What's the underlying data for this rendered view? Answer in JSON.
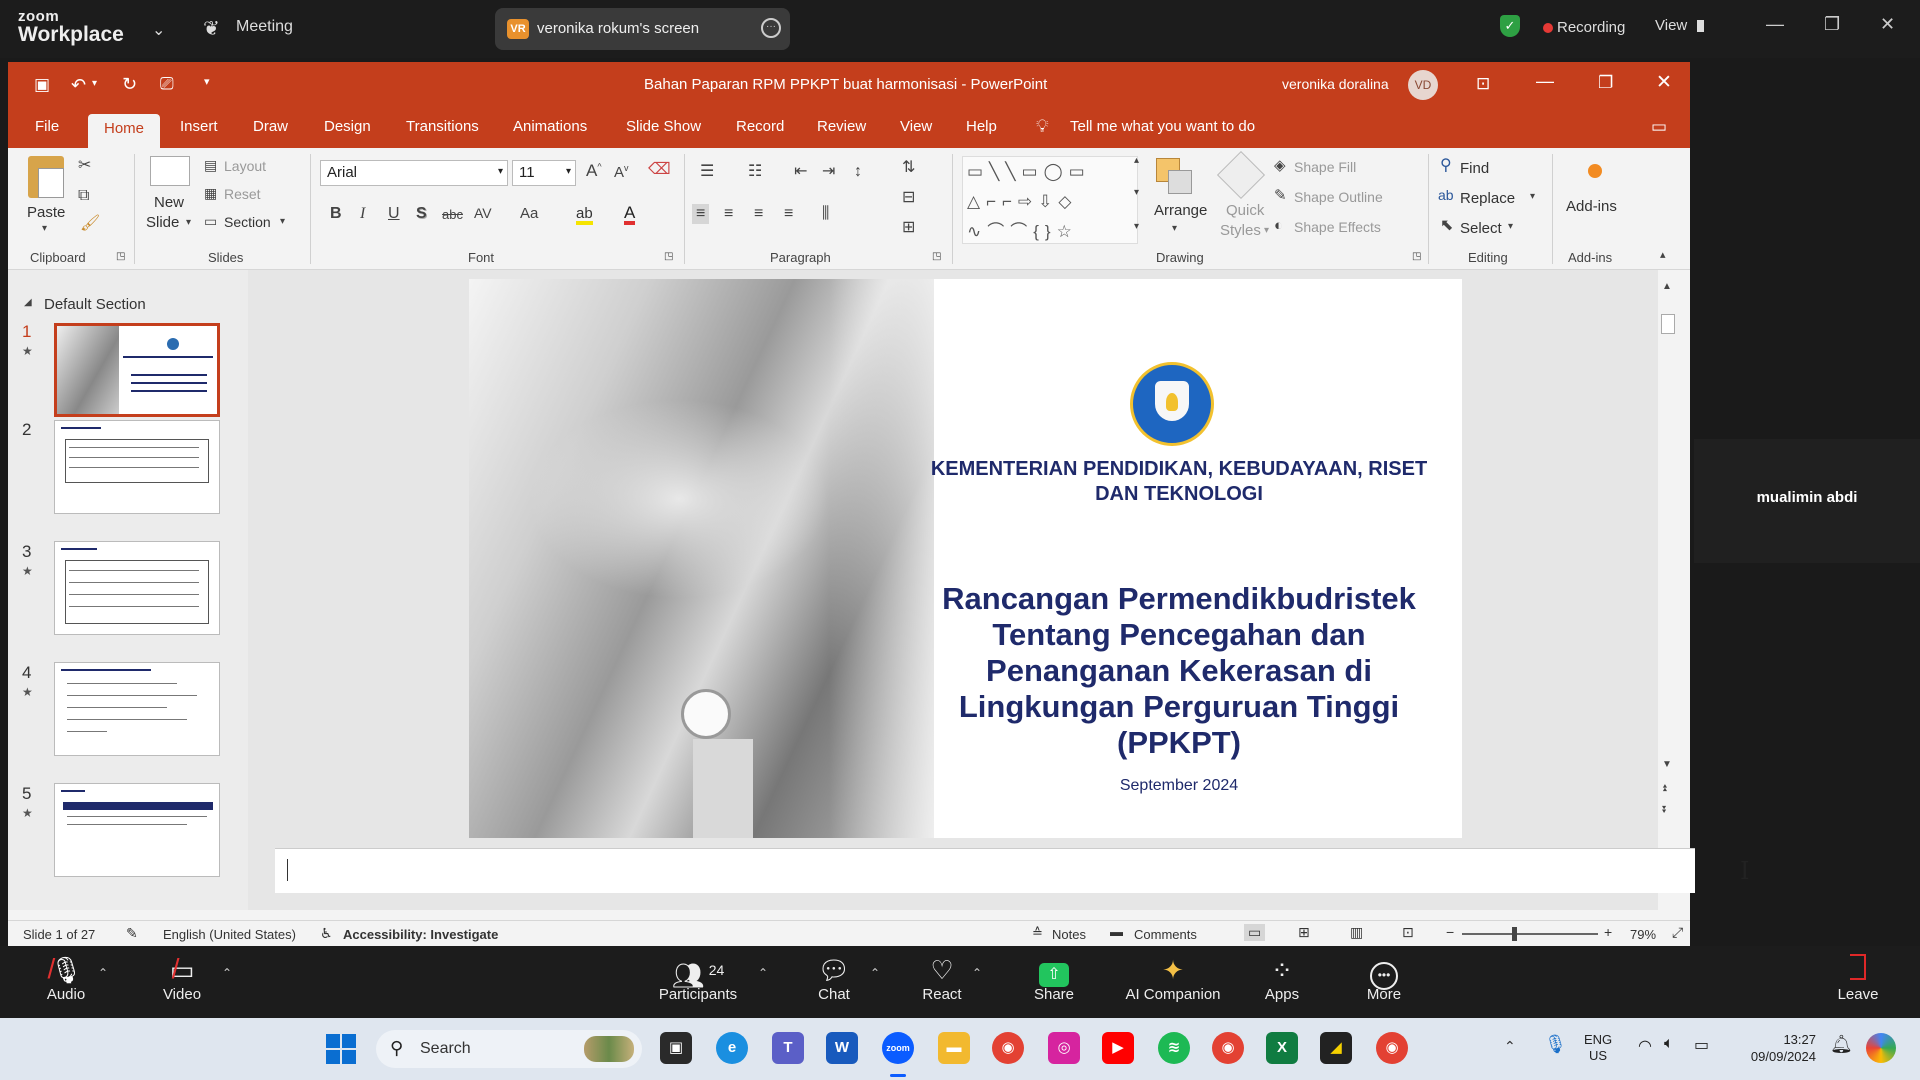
{
  "zoom": {
    "brand_top": "zoom",
    "brand_bottom": "Workplace",
    "meeting_label": "Meeting",
    "share_initials": "VR",
    "share_label": "veronika rokum's screen",
    "recording_label": "Recording",
    "view_label": "View",
    "participant_name": "mualimin abdi",
    "participants_count": "24",
    "toolbar": {
      "audio": "Audio",
      "video": "Video",
      "participants": "Participants",
      "chat": "Chat",
      "react": "React",
      "share": "Share",
      "ai": "AI Companion",
      "apps": "Apps",
      "more": "More",
      "leave": "Leave"
    },
    "colors": {
      "recording_dot": "#e53935",
      "share_green": "#22c55e",
      "leave_red": "#e02828"
    }
  },
  "ppt": {
    "title": "Bahan Paparan RPM PPKPT buat harmonisasi  -  PowerPoint",
    "user_name": "veronika doralina",
    "user_initials": "VD",
    "accent": "#c43e1c",
    "tabs": [
      "File",
      "Home",
      "Insert",
      "Draw",
      "Design",
      "Transitions",
      "Animations",
      "Slide Show",
      "Record",
      "Review",
      "View",
      "Help"
    ],
    "tell_me": "Tell me what you want to do",
    "ribbon": {
      "paste": "Paste",
      "new_slide_1": "New",
      "new_slide_2": "Slide",
      "layout": "Layout",
      "reset": "Reset",
      "section": "Section",
      "font_name": "Arial",
      "font_size": "11",
      "arrange": "Arrange",
      "quick_styles_1": "Quick",
      "quick_styles_2": "Styles",
      "shape_fill": "Shape Fill",
      "shape_outline": "Shape Outline",
      "shape_effects": "Shape Effects",
      "find": "Find",
      "replace": "Replace",
      "select": "Select",
      "addins": "Add-ins",
      "groups": {
        "clipboard": "Clipboard",
        "slides": "Slides",
        "font": "Font",
        "paragraph": "Paragraph",
        "drawing": "Drawing",
        "editing": "Editing",
        "addins": "Add-ins"
      }
    },
    "section_name": "Default Section",
    "thumbs": [
      {
        "num": "1"
      },
      {
        "num": "2"
      },
      {
        "num": "3"
      },
      {
        "num": "4"
      },
      {
        "num": "5"
      }
    ],
    "slide": {
      "ministry_line1": "KEMENTERIAN PENDIDIKAN, KEBUDAYAAN, RISET",
      "ministry_line2": "DAN TEKNOLOGI",
      "title_lines": [
        "Rancangan Permendikbudristek",
        "Tentang Pencegahan dan",
        "Penanganan Kekerasan di",
        "Lingkungan Perguruan Tinggi",
        "(PPKPT)"
      ],
      "date": "September 2024",
      "title_color": "#1f2a6b"
    },
    "status": {
      "slide_of": "Slide 1 of 27",
      "language": "English (United States)",
      "accessibility": "Accessibility: Investigate",
      "notes": "Notes",
      "comments": "Comments",
      "zoom": "79%"
    }
  },
  "taskbar": {
    "search_label": "Search",
    "lang_1": "ENG",
    "lang_2": "US",
    "time": "13:27",
    "date": "09/09/2024"
  }
}
